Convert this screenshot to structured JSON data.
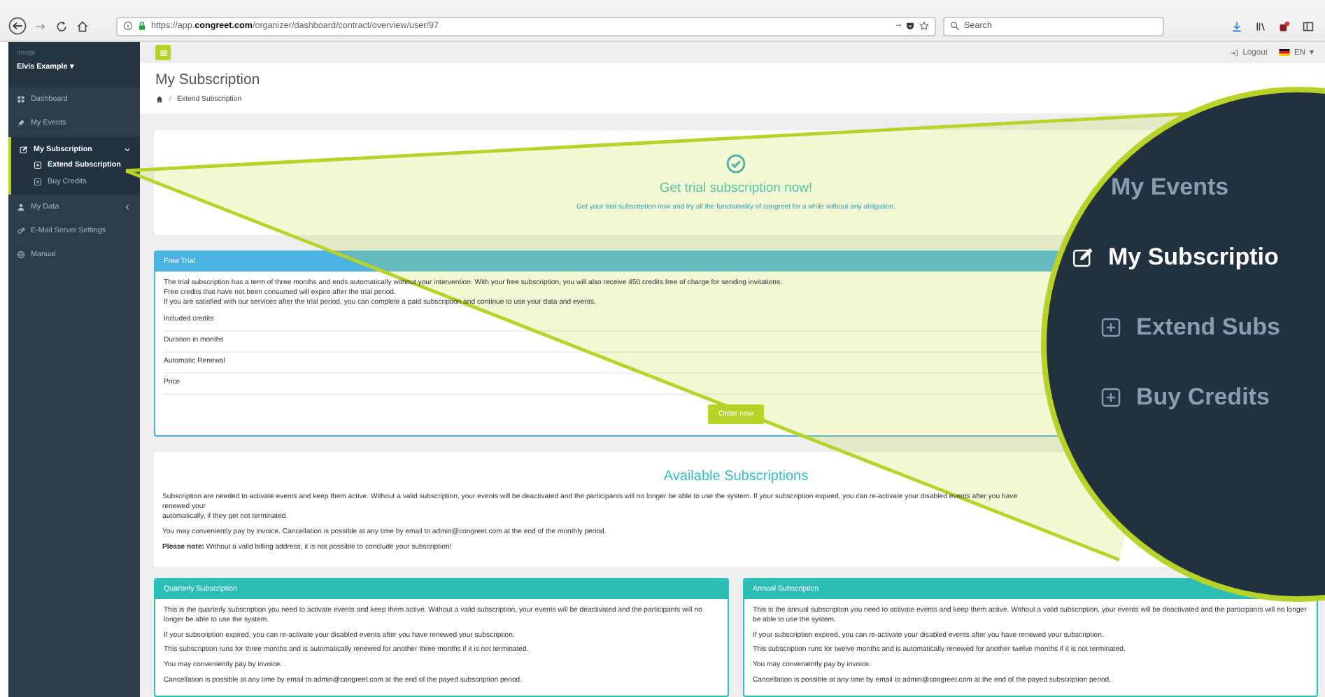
{
  "browser": {
    "url": "https://app.**congreet.com**/organizer/dashboard/contract/overview/user/97",
    "more": "···",
    "search_placeholder": "Search"
  },
  "header": {
    "logout": "Logout",
    "language": "EN",
    "language_caret": "▾"
  },
  "sidebar": {
    "image_alt": "Image",
    "user_name": "Elvis Example",
    "user_caret": "▾",
    "items": [
      {
        "label": "Dashboard",
        "selected": false
      },
      {
        "label": "My Events",
        "selected": false
      },
      {
        "label": "My Subscription",
        "selected": true,
        "expanded": true,
        "children": [
          {
            "label": "Extend Subscription",
            "selected": true
          },
          {
            "label": "Buy Credits",
            "selected": false
          }
        ]
      },
      {
        "label": "My Data",
        "selected": false,
        "expanded": false
      },
      {
        "label": "E-Mail Server Settings",
        "selected": false
      },
      {
        "label": "Manual",
        "selected": false
      }
    ]
  },
  "page": {
    "title": "My Subscription",
    "breadcrumb_separator": "/",
    "breadcrumb": "Extend Subscription"
  },
  "trial_banner": {
    "title": "Get trial subscription now!",
    "subtitle": "Get your trial subscription now and try all the functionality of congreet for a while without any obligation."
  },
  "free_trial": {
    "header": "Free Trial",
    "paragraphs": [
      "The trial subscription has a term of three months and ends automatically without your intervention. With your free subscription, you will also receive 450 credits free of charge for sending invitations.",
      "Free credits that have not been consumed will expire after the trial period.",
      "If you are satisfied with our services after the trial period, you can complete a paid subscription and continue to use your data and events."
    ],
    "rows": [
      "Included credits",
      "Duration in months",
      "Automatic Renewal",
      "Price"
    ],
    "button": "Order now"
  },
  "available": {
    "title": "Available Subscriptions",
    "paragraphs": [
      "Subscription are needed to activate events and keep them active. Without a valid subscription, your events will be deactivated and the participants will no longer be able to use the system. If your subscription expired, you can re-activate your disabled events after you have renewed your",
      "automatically, if they get not terminated.",
      "You may conveniently pay by invoice. Cancellation is possible at any time by email to admin@congreet.com at the end of the monthly period.",
      "**Please note:** Without a valid billing address, it is not possible to conclude your subscription!"
    ]
  },
  "plans": [
    {
      "header": "Quarterly Subscription",
      "paragraphs": [
        "This is the quarterly subscription you need to activate events and keep them active. Without a valid subscription, your events will be deactivated and the participants will no longer be able to use the system.",
        "If your subscription expired, you can re-activate your disabled events after you have renewed your subscription.",
        "This subscription runs for three months and is automatically renewed for another three months if it is not terminated.",
        "You may conveniently pay by invoice.",
        "Cancellation is possible at any time by email to admin@congreet.com at the end of the payed subscription period."
      ]
    },
    {
      "header": "Annual Subscription",
      "paragraphs": [
        "This is the annual subscription you need to activate events and keep them active. Without a valid subscription, your events will be deactivated and the participants will no longer be able to use the system.",
        "If your subscription expired, you can re-activate your disabled events after you have renewed your subscription.",
        "This subscription runs for twelve months and is automatically renewed for another twelve months if it is not terminated.",
        "You may conveniently pay by invoice.",
        "Cancellation is possible at any time by email to admin@congreet.com at the end of the payed subscription period."
      ]
    }
  ],
  "magnifier": {
    "items": [
      {
        "label": "My Events",
        "kind": "item",
        "selected": false
      },
      {
        "label": "My Subscriptio",
        "kind": "item",
        "selected": true
      },
      {
        "label": "Extend Subs",
        "kind": "child",
        "selected": false
      },
      {
        "label": "Buy Credits",
        "kind": "child",
        "selected": false
      }
    ]
  }
}
